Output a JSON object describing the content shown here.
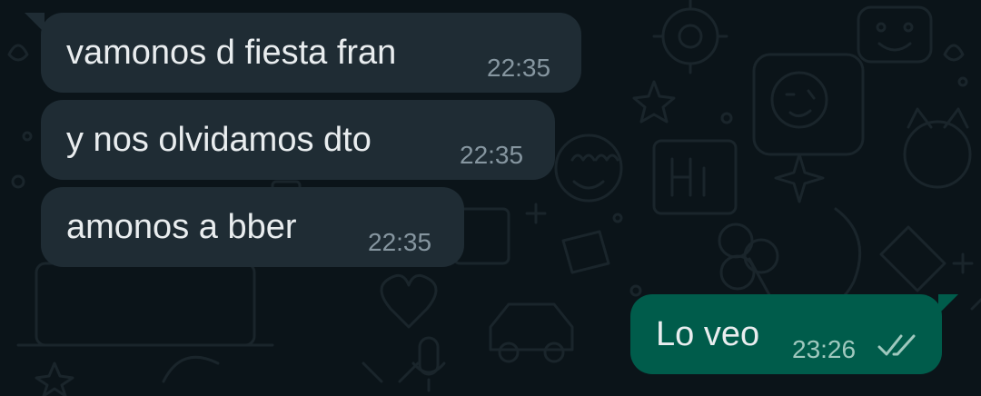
{
  "messages": [
    {
      "text": "vamonos d fiesta fran",
      "time": "22:35",
      "direction": "incoming"
    },
    {
      "text": "y nos olvidamos dto",
      "time": "22:35",
      "direction": "incoming"
    },
    {
      "text": "amonos a bber",
      "time": "22:35",
      "direction": "incoming"
    },
    {
      "text": "Lo veo",
      "time": "23:26",
      "direction": "outgoing",
      "status": "delivered-double-tick"
    }
  ],
  "colors": {
    "background": "#0b1419",
    "incoming_bubble": "#1f2c34",
    "outgoing_bubble": "#005c4b",
    "message_text": "#e9edef",
    "timestamp": "#8696a0"
  },
  "icons": {
    "read_receipt": "double-check-icon"
  }
}
